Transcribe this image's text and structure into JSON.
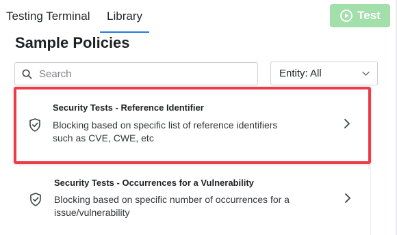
{
  "tabs": [
    {
      "label": "Testing Terminal",
      "active": false
    },
    {
      "label": "Library",
      "active": true
    }
  ],
  "test_button": {
    "label": "Test",
    "icon": "play-circle-icon"
  },
  "page_title": "Sample Policies",
  "search": {
    "placeholder": "Search",
    "value": ""
  },
  "entity_filter": {
    "label": "Entity: All"
  },
  "policies": [
    {
      "title": "Security Tests - Reference Identifier",
      "description": "Blocking based on specific list of reference identifiers such as CVE, CWE, etc",
      "icon": "shield-check-icon",
      "selected": true
    },
    {
      "title": "Security Tests - Occurrences for a Vulnerability",
      "description": "Blocking based on specific number of occurrences for a issue/vulnerability",
      "icon": "shield-check-icon",
      "selected": false
    }
  ],
  "colors": {
    "accent": "#1f7ae0",
    "test_button_bg": "#a2dfab",
    "highlight_border": "#ef3b47"
  }
}
